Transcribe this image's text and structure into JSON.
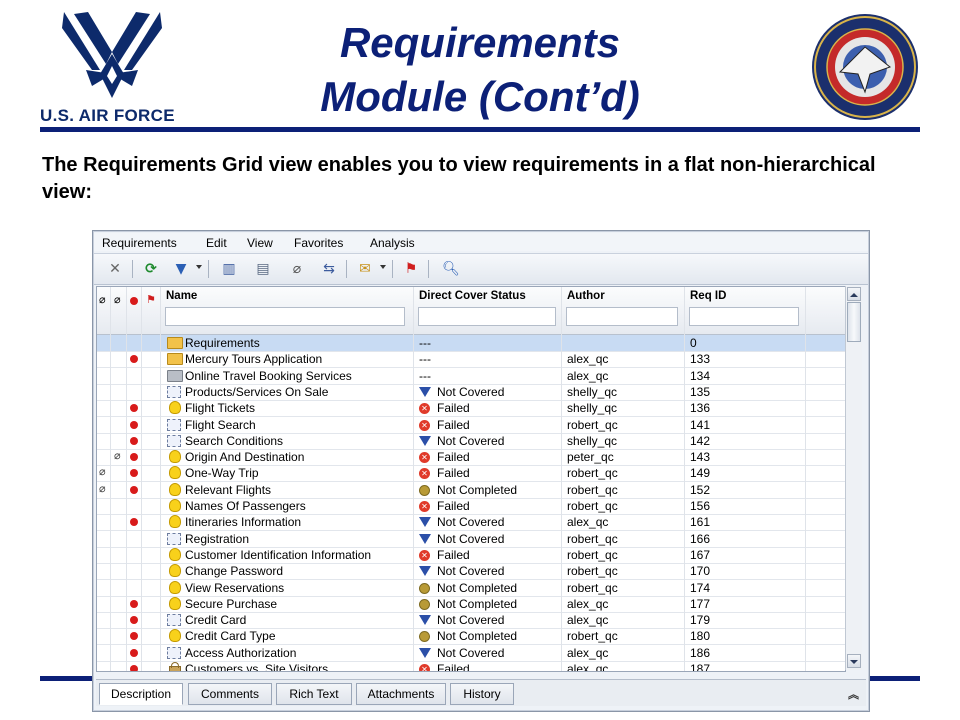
{
  "slide": {
    "logo_text": "U.S. AIR FORCE",
    "title_line1": "Requirements",
    "title_line2": "Module (Cont’d)",
    "intro": "The Requirements Grid view enables you to view requirements in a flat non-hierarchical view:",
    "brand_color": "#0c2077"
  },
  "menu": [
    "Requirements",
    "Edit",
    "View",
    "Favorites",
    "Analysis"
  ],
  "toolbar": [
    "delete-icon",
    "refresh-icon",
    "filter-icon",
    "columns-icon",
    "edit-icon",
    "attachment-icon",
    "convert-icon",
    "mail-icon",
    "flag-icon",
    "find-icon"
  ],
  "columns": {
    "name": "Name",
    "status": "Direct Cover Status",
    "author": "Author",
    "reqid": "Req ID"
  },
  "rows": [
    {
      "attach": false,
      "link": false,
      "alert": false,
      "type": "folder",
      "name": "Requirements",
      "status": "---",
      "status_icon": "",
      "author": "",
      "reqid": "0",
      "selected": true
    },
    {
      "attach": false,
      "link": false,
      "alert": true,
      "type": "folder",
      "name": "Mercury Tours Application",
      "status": "---",
      "status_icon": "",
      "author": "alex_qc",
      "reqid": "133"
    },
    {
      "attach": false,
      "link": false,
      "alert": false,
      "type": "folder-gray",
      "name": "Online Travel Booking Services",
      "status": "---",
      "status_icon": "",
      "author": "alex_qc",
      "reqid": "134"
    },
    {
      "attach": false,
      "link": false,
      "alert": false,
      "type": "list",
      "name": "Products/Services On Sale",
      "status": "Not Covered",
      "status_icon": "nc",
      "author": "shelly_qc",
      "reqid": "135"
    },
    {
      "attach": false,
      "link": false,
      "alert": true,
      "type": "bulb",
      "name": "Flight Tickets",
      "status": "Failed",
      "status_icon": "failed",
      "author": "shelly_qc",
      "reqid": "136"
    },
    {
      "attach": false,
      "link": false,
      "alert": true,
      "type": "list",
      "name": "Flight Search",
      "status": "Failed",
      "status_icon": "failed",
      "author": "robert_qc",
      "reqid": "141"
    },
    {
      "attach": false,
      "link": false,
      "alert": true,
      "type": "list",
      "name": "Search Conditions",
      "status": "Not Covered",
      "status_icon": "nc",
      "author": "shelly_qc",
      "reqid": "142"
    },
    {
      "attach": false,
      "link": true,
      "alert": true,
      "type": "bulb",
      "name": "Origin And Destination",
      "status": "Failed",
      "status_icon": "failed",
      "author": "peter_qc",
      "reqid": "143"
    },
    {
      "attach": true,
      "link": false,
      "alert": true,
      "type": "bulb",
      "name": "One-Way Trip",
      "status": "Failed",
      "status_icon": "failed",
      "author": "robert_qc",
      "reqid": "149"
    },
    {
      "attach": true,
      "link": false,
      "alert": true,
      "type": "bulb",
      "name": "Relevant Flights",
      "status": "Not Completed",
      "status_icon": "ncomp",
      "author": "robert_qc",
      "reqid": "152"
    },
    {
      "attach": false,
      "link": false,
      "alert": false,
      "type": "bulb",
      "name": "Names Of Passengers",
      "status": "Failed",
      "status_icon": "failed",
      "author": "robert_qc",
      "reqid": "156"
    },
    {
      "attach": false,
      "link": false,
      "alert": true,
      "type": "bulb",
      "name": "Itineraries Information",
      "status": "Not Covered",
      "status_icon": "nc",
      "author": "alex_qc",
      "reqid": "161"
    },
    {
      "attach": false,
      "link": false,
      "alert": false,
      "type": "list",
      "name": "Registration",
      "status": "Not Covered",
      "status_icon": "nc",
      "author": "robert_qc",
      "reqid": "166"
    },
    {
      "attach": false,
      "link": false,
      "alert": false,
      "type": "bulb",
      "name": "Customer Identification Information",
      "status": "Failed",
      "status_icon": "failed",
      "author": "robert_qc",
      "reqid": "167"
    },
    {
      "attach": false,
      "link": false,
      "alert": false,
      "type": "bulb",
      "name": "Change Password",
      "status": "Not Covered",
      "status_icon": "nc",
      "author": "robert_qc",
      "reqid": "170"
    },
    {
      "attach": false,
      "link": false,
      "alert": false,
      "type": "bulb",
      "name": "View Reservations",
      "status": "Not Completed",
      "status_icon": "ncomp",
      "author": "robert_qc",
      "reqid": "174"
    },
    {
      "attach": false,
      "link": false,
      "alert": true,
      "type": "bulb",
      "name": "Secure Purchase",
      "status": "Not Completed",
      "status_icon": "ncomp",
      "author": "alex_qc",
      "reqid": "177"
    },
    {
      "attach": false,
      "link": false,
      "alert": true,
      "type": "list",
      "name": "Credit Card",
      "status": "Not Covered",
      "status_icon": "nc",
      "author": "alex_qc",
      "reqid": "179"
    },
    {
      "attach": false,
      "link": false,
      "alert": true,
      "type": "bulb",
      "name": "Credit Card Type",
      "status": "Not Completed",
      "status_icon": "ncomp",
      "author": "robert_qc",
      "reqid": "180"
    },
    {
      "attach": false,
      "link": false,
      "alert": true,
      "type": "list",
      "name": "Access Authorization",
      "status": "Not Covered",
      "status_icon": "nc",
      "author": "alex_qc",
      "reqid": "186"
    },
    {
      "attach": false,
      "link": false,
      "alert": true,
      "type": "lock",
      "name": "Customers vs. Site Visitors",
      "status": "Failed",
      "status_icon": "failed",
      "author": "alex_qc",
      "reqid": "187"
    }
  ],
  "tabs": [
    "Description",
    "Comments",
    "Rich Text",
    "Attachments",
    "History"
  ],
  "active_tab": "Description"
}
